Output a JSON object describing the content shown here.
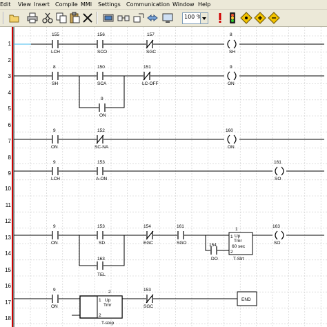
{
  "menu": [
    "Edit",
    "View",
    "Insert",
    "Compile",
    "MMI",
    "Settings",
    "Communication",
    "Window",
    "Help"
  ],
  "zoom": "100 %",
  "toolbar_icons": [
    "open-icon",
    "save-icon",
    "print-icon",
    "cut-icon",
    "copy-icon",
    "paste-icon",
    "delete-icon",
    "compile-icon",
    "connect-icon",
    "zoom-out-icon",
    "zoom-in-icon",
    "monitor-icon",
    "traffic-light-icon",
    "diamond-icon",
    "diamond-icon",
    "diamond-icon"
  ],
  "rows": [
    "1",
    "2",
    "3",
    "4",
    "5",
    "6",
    "7",
    "8",
    "9",
    "10",
    "11",
    "12",
    "13",
    "14",
    "15",
    "16",
    "17",
    "18"
  ],
  "rung1": {
    "c1_num": "155",
    "c1_lbl": "LCH",
    "c2_num": "156",
    "c2_lbl": "SCO",
    "c3_num": "157",
    "c3_lbl": "SGC",
    "coil_num": "8",
    "coil_lbl": "SH"
  },
  "rung3": {
    "c1_num": "8",
    "c1_lbl": "SH",
    "c2_num": "150",
    "c2_lbl": "SCA",
    "c3_num": "151",
    "c3_lbl": "LC-OFF",
    "coil_num": "9",
    "coil_lbl": "ON",
    "p_num": "9",
    "p_lbl": "ON"
  },
  "rung7": {
    "c1_num": "9",
    "c1_lbl": "ON",
    "c2_num": "152",
    "c2_lbl": "SC-NA",
    "coil_num": "160",
    "coil_lbl": "ON"
  },
  "rung9": {
    "c1_num": "9",
    "c1_lbl": "LCH",
    "c2_num": "153",
    "c2_lbl": "A-ON",
    "coil_num": "161",
    "coil_lbl": "SO"
  },
  "rung13": {
    "c1_num": "9",
    "c1_lbl": "ON",
    "c2_num": "153",
    "c2_lbl": "SD",
    "c3_num": "154",
    "c3_lbl": "EGC",
    "c4_num": "161",
    "c4_lbl": "SGO",
    "p1_num": "163",
    "p1_lbl": "TEL",
    "p2_num": "154",
    "p2_lbl": "DO",
    "timer_num": "1",
    "timer_l1": "Up",
    "timer_l2": "Tmr",
    "timer_l3": "60 sec",
    "timer_lbl": "T-Strt",
    "timer_in1": "1",
    "timer_in2": "2",
    "coil_num": "163",
    "coil_lbl": "SO"
  },
  "rung17": {
    "c1_num": "9",
    "c1_lbl": "ON",
    "timer_num": "2",
    "timer_l1": "Up",
    "timer_l2": "Tmr",
    "timer_lbl": "T-stop",
    "timer_in1": "1",
    "timer_in2": "2",
    "c2_num": "153",
    "c2_lbl": "SGC",
    "end_lbl": "END"
  }
}
